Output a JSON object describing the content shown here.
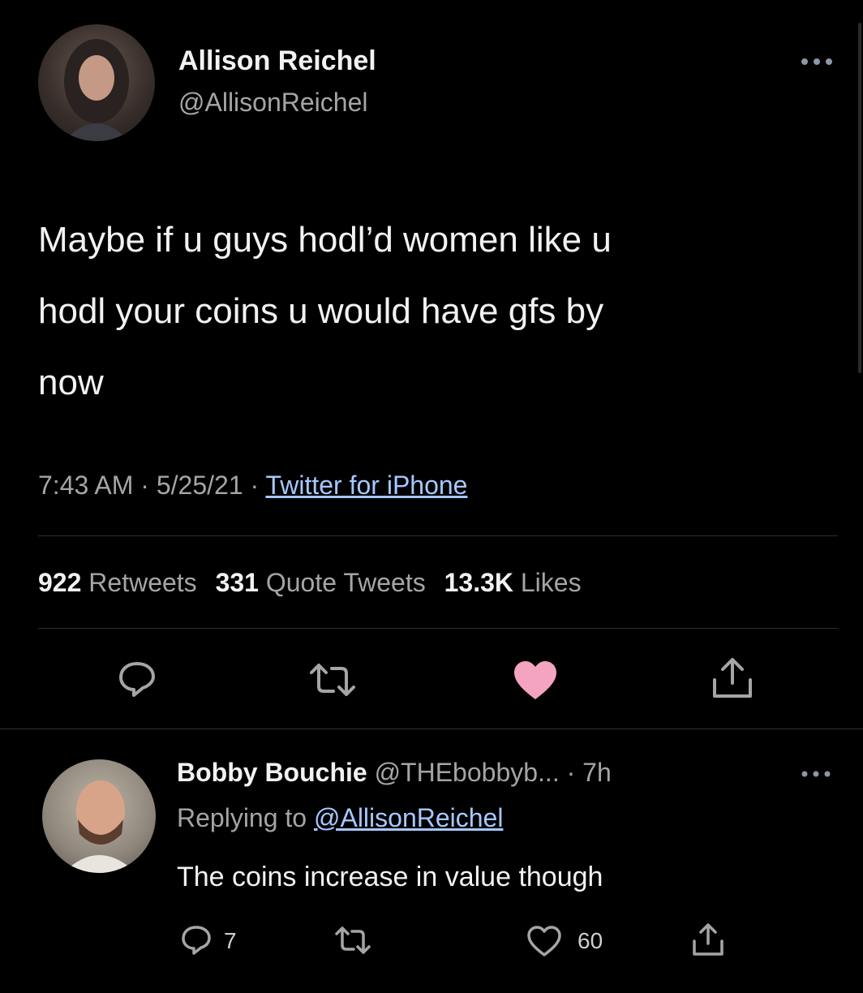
{
  "main_tweet": {
    "author_name": "Allison Reichel",
    "author_handle": "@AllisonReichel",
    "more_icon": "more-horizontal-icon",
    "text_lines": [
      "Maybe if u guys hodl’d women like u",
      "hodl your coins u would have gfs by",
      "now"
    ],
    "time": "7:43 AM",
    "date": "5/25/21",
    "separator": "·",
    "source": "Twitter for iPhone",
    "stats": {
      "retweets_count": "922",
      "retweets_label": "Retweets",
      "quotes_count": "331",
      "quotes_label": "Quote Tweets",
      "likes_count": "13.3K",
      "likes_label": "Likes"
    },
    "actions": [
      "reply-icon",
      "retweet-icon",
      "like-icon",
      "share-icon"
    ],
    "liked": true,
    "like_color": "#f4a3c0"
  },
  "reply": {
    "author_name": "Bobby Bouchie",
    "author_handle": "@THEbobbyb...",
    "age": "· 7h",
    "replying_prefix": "Replying to",
    "replying_handle": "@AllisonReichel",
    "text": "The coins increase in value though",
    "reply_count": "7",
    "like_count": "60"
  },
  "colors": {
    "background": "#000000",
    "text": "#e7e9ea",
    "muted": "#8b98a5",
    "link": "#a6c8ff"
  }
}
